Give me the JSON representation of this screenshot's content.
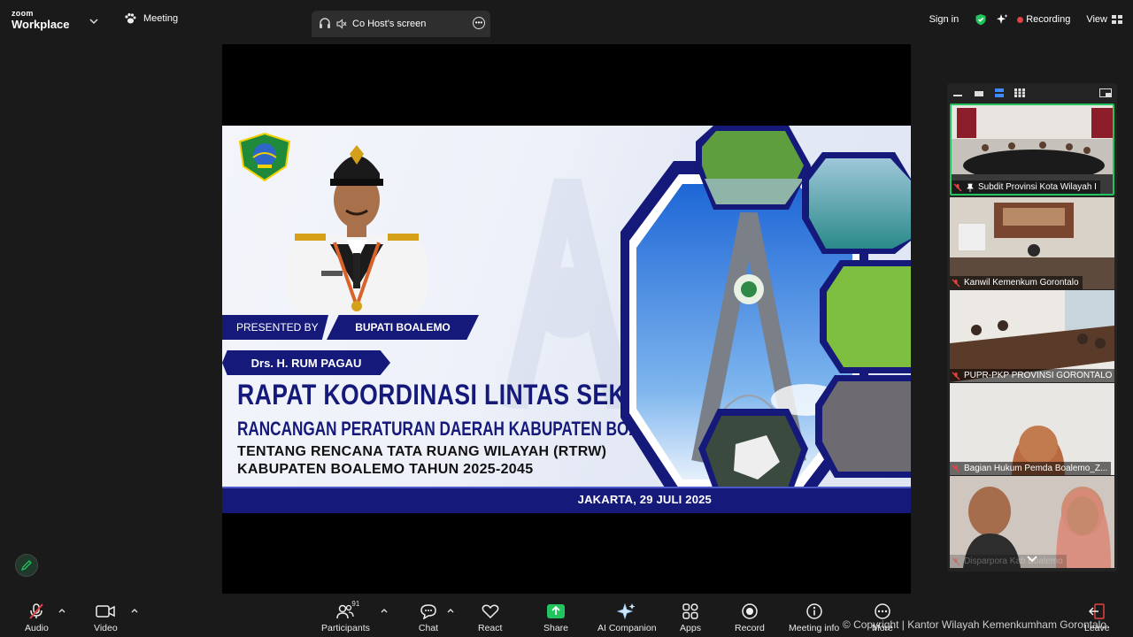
{
  "app": {
    "brand_small": "zoom",
    "brand_large": "Workplace"
  },
  "tabs": {
    "meeting": "Meeting",
    "cohost": "Co Host's screen"
  },
  "header": {
    "sign_in": "Sign in",
    "recording": "Recording",
    "view": "View"
  },
  "slide": {
    "presented_by": "PRESENTED BY",
    "role": "BUPATI BOALEMO",
    "presenter": "Drs. H. RUM PAGAU",
    "title": "RAPAT KOORDINASI LINTAS SEKTOR",
    "subtitle": "RANCANGAN PERATURAN DAERAH KABUPATEN BOALEMO",
    "line3": "TENTANG RENCANA TATA RUANG WILAYAH (RTRW)",
    "line4": "KABUPATEN BOALEMO TAHUN 2025-2045",
    "place_date": "JAKARTA, 29 JULI 2025"
  },
  "participants_panel": {
    "tiles": [
      {
        "name": "Subdit Provinsi Kota Wilayah I",
        "active": true
      },
      {
        "name": "Kanwil Kemenkum Gorontalo",
        "active": false
      },
      {
        "name": "PUPR-PKP PROVINSI GORONTALO",
        "active": false
      },
      {
        "name": "Bagian Hukum Pemda Boalemo_Z...",
        "active": false
      },
      {
        "name": "Disparpora Kab Boalemo",
        "active": false
      }
    ]
  },
  "toolbar": {
    "audio": "Audio",
    "video": "Video",
    "participants": "Participants",
    "participants_count": "91",
    "chat": "Chat",
    "react": "React",
    "share": "Share",
    "ai_companion": "AI Companion",
    "apps": "Apps",
    "record": "Record",
    "meeting_info": "Meeting info",
    "more": "More",
    "leave": "Leave"
  },
  "watermark_text": "© Copyright | Kantor Wilayah Kemenkumham Gorontalo",
  "colors": {
    "accent_green": "#21c45d",
    "recording_red": "#e24242",
    "slide_navy": "#14197a"
  }
}
